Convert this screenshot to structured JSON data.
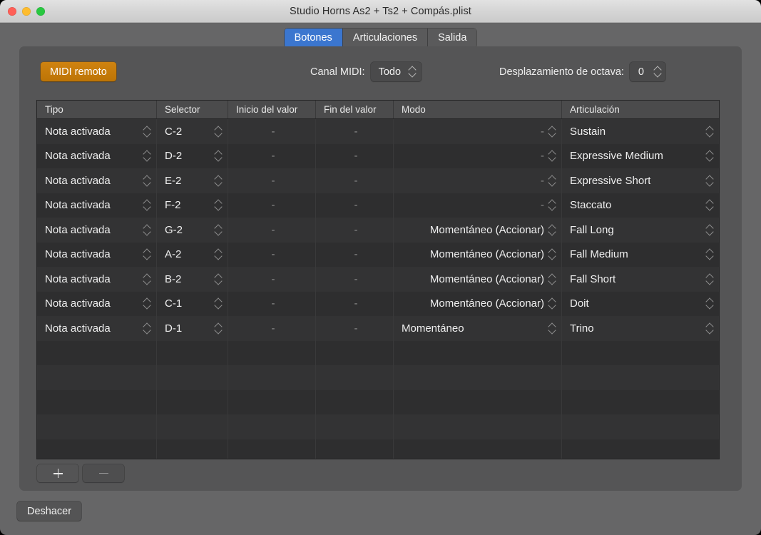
{
  "window": {
    "title": "Studio Horns As2 + Ts2 + Compás.plist",
    "traffic_lights": [
      "close-button",
      "minimize-button",
      "zoom-button"
    ],
    "accent_color": "#3b76cf",
    "highlight_color": "#cf8310",
    "panel_color": "#555556",
    "table_bg": "#333334"
  },
  "tabs": [
    {
      "label": "Botones",
      "active": true
    },
    {
      "label": "Articulaciones",
      "active": false
    },
    {
      "label": "Salida",
      "active": false
    }
  ],
  "controls": {
    "midi_remote_label": "MIDI remoto",
    "midi_channel_label": "Canal MIDI:",
    "midi_channel_value": "Todo",
    "octave_shift_label": "Desplazamiento de octava:",
    "octave_shift_value": "0"
  },
  "table": {
    "columns": [
      "Tipo",
      "Selector",
      "Inicio del valor",
      "Fin del valor",
      "Modo",
      "Articulación"
    ],
    "rows": [
      {
        "tipo": "Nota activada",
        "selector": "C-2",
        "inicio": "-",
        "fin": "-",
        "modo": "-",
        "articulacion": "Sustain"
      },
      {
        "tipo": "Nota activada",
        "selector": "D-2",
        "inicio": "-",
        "fin": "-",
        "modo": "-",
        "articulacion": "Expressive Medium"
      },
      {
        "tipo": "Nota activada",
        "selector": "E-2",
        "inicio": "-",
        "fin": "-",
        "modo": "-",
        "articulacion": "Expressive Short"
      },
      {
        "tipo": "Nota activada",
        "selector": "F-2",
        "inicio": "-",
        "fin": "-",
        "modo": "-",
        "articulacion": "Staccato"
      },
      {
        "tipo": "Nota activada",
        "selector": "G-2",
        "inicio": "-",
        "fin": "-",
        "modo": "Momentáneo (Accionar)",
        "articulacion": "Fall Long"
      },
      {
        "tipo": "Nota activada",
        "selector": "A-2",
        "inicio": "-",
        "fin": "-",
        "modo": "Momentáneo (Accionar)",
        "articulacion": "Fall Medium"
      },
      {
        "tipo": "Nota activada",
        "selector": "B-2",
        "inicio": "-",
        "fin": "-",
        "modo": "Momentáneo (Accionar)",
        "articulacion": "Fall Short"
      },
      {
        "tipo": "Nota activada",
        "selector": "C-1",
        "inicio": "-",
        "fin": "-",
        "modo": "Momentáneo (Accionar)",
        "articulacion": "Doit"
      },
      {
        "tipo": "Nota activada",
        "selector": "D-1",
        "inicio": "-",
        "fin": "-",
        "modo": "Momentáneo",
        "articulacion": "Trino"
      }
    ],
    "empty_row_count": 5
  },
  "footer": {
    "add_label": "+",
    "remove_label": "−",
    "undo_label": "Deshacer"
  }
}
